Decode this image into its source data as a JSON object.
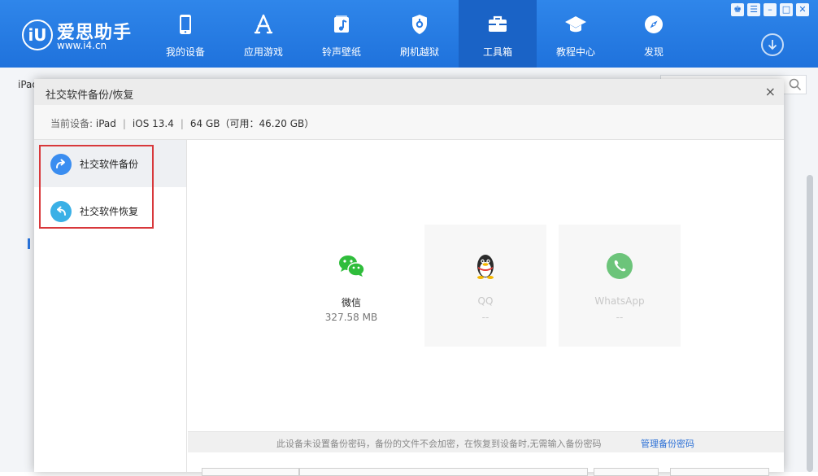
{
  "app": {
    "logo_mark": "iU",
    "name": "爱思助手",
    "url": "www.i4.cn"
  },
  "nav": [
    {
      "label": "我的设备",
      "icon": "phone-icon"
    },
    {
      "label": "应用游戏",
      "icon": "appstore-icon"
    },
    {
      "label": "铃声壁纸",
      "icon": "music-icon"
    },
    {
      "label": "刷机越狱",
      "icon": "shield-icon"
    },
    {
      "label": "工具箱",
      "icon": "toolbox-icon",
      "active": true
    },
    {
      "label": "教程中心",
      "icon": "graduation-cap-icon"
    },
    {
      "label": "发现",
      "icon": "compass-icon"
    }
  ],
  "window_controls": [
    "shirt-icon",
    "list-icon",
    "minimize-icon",
    "maximize-icon",
    "close-icon"
  ],
  "background": {
    "tab_label": "iPad"
  },
  "dialog": {
    "title": "社交软件备份/恢复",
    "close_symbol": "×",
    "device_prefix": "当前设备: ",
    "device_name": "iPad",
    "ios_version": "iOS 13.4",
    "storage": "64 GB（可用：46.20 GB）",
    "separator": "|",
    "menu": [
      {
        "label": "社交软件备份",
        "icon": "backup-arrow-icon",
        "active": true
      },
      {
        "label": "社交软件恢复",
        "icon": "restore-arrow-icon",
        "active": false
      }
    ],
    "apps": [
      {
        "name": "微信",
        "size": "327.58 MB",
        "icon": "wechat-icon",
        "enabled": true
      },
      {
        "name": "QQ",
        "size": "--",
        "icon": "qq-penguin-icon",
        "enabled": false
      },
      {
        "name": "WhatsApp",
        "size": "--",
        "icon": "whatsapp-icon",
        "enabled": false
      }
    ],
    "footer_text": "此设备未设置备份密码，备份的文件不会加密，在恢复到设备时,无需输入备份密码",
    "footer_link": "管理备份密码"
  },
  "colors": {
    "topbar": "#1f72dc",
    "nav_active": "#1a63c6",
    "wechat_green": "#2fbd3b",
    "backup_icon": "#3a8df0",
    "restore_icon": "#3ab0e6",
    "highlight_red": "#d8383b",
    "link_blue": "#2a6fd6"
  }
}
